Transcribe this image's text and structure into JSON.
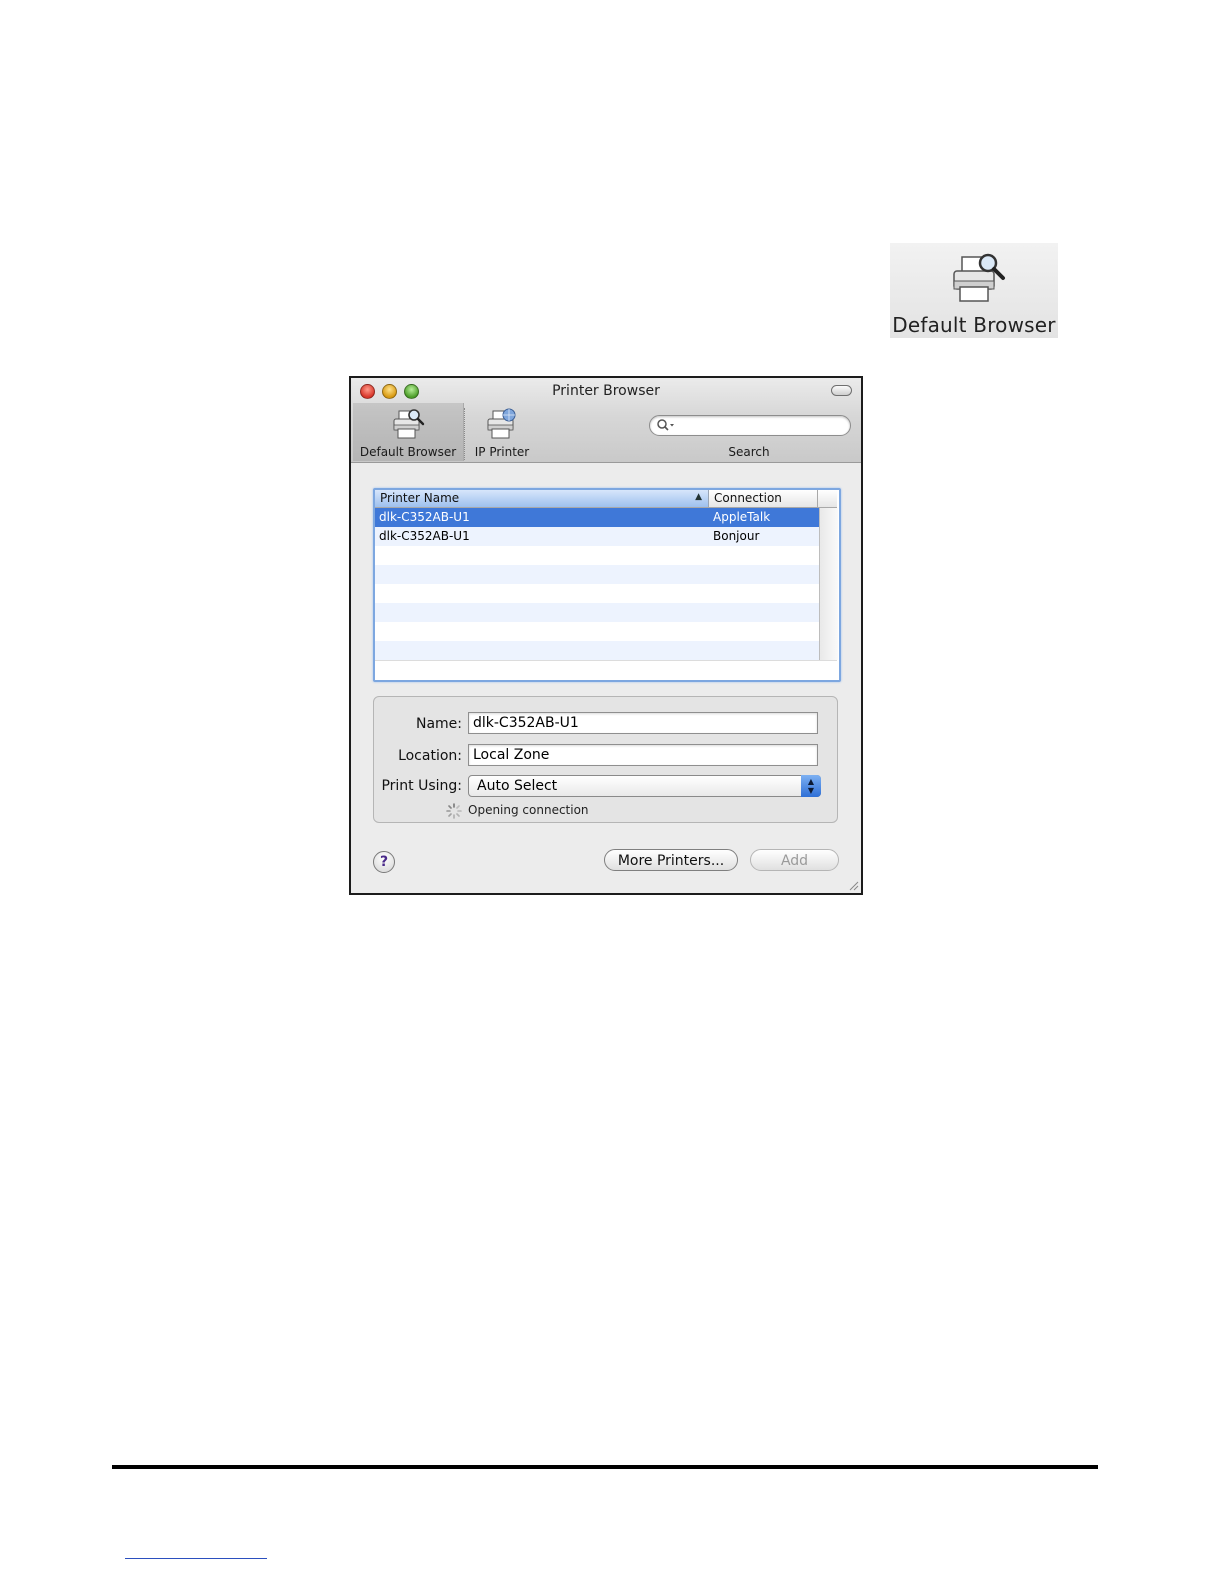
{
  "standalone_icon": {
    "label": "Default Browser",
    "icon": "printer-magnifier-icon"
  },
  "window": {
    "title": "Printer Browser",
    "toolbar": {
      "items": [
        {
          "label": "Default Browser",
          "icon": "printer-magnifier-icon",
          "selected": true
        },
        {
          "label": "IP Printer",
          "icon": "printer-globe-icon",
          "selected": false
        }
      ],
      "search": {
        "label": "Search",
        "value": "",
        "placeholder": ""
      }
    },
    "printer_list": {
      "columns": [
        "Printer Name",
        "Connection"
      ],
      "sort_column": "Printer Name",
      "sort_direction": "ascending",
      "rows": [
        {
          "name": "dlk-C352AB-U1",
          "connection": "AppleTalk",
          "selected": true
        },
        {
          "name": "dlk-C352AB-U1",
          "connection": "Bonjour",
          "selected": false
        }
      ]
    },
    "info": {
      "name_label": "Name:",
      "name_value": "dlk-C352AB-U1",
      "location_label": "Location:",
      "location_value": "Local Zone",
      "print_using_label": "Print Using:",
      "print_using_value": "Auto Select",
      "status_text": "Opening connection"
    },
    "buttons": {
      "help": "?",
      "more_printers": "More Printers...",
      "add": "Add"
    }
  },
  "colors": {
    "selection": "#3f78d8",
    "list_border": "#7da7e0",
    "alt_row": "#edf3fe"
  }
}
